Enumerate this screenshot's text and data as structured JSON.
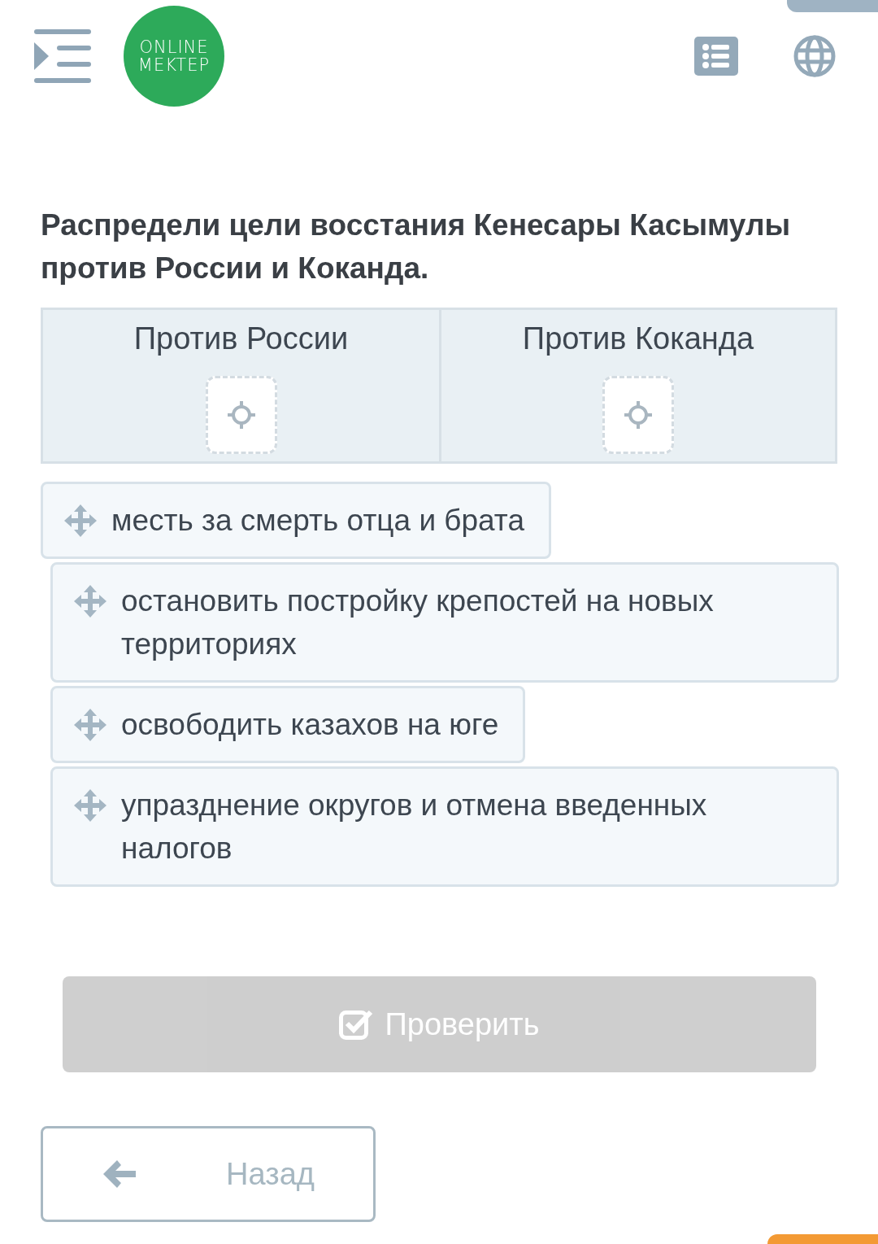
{
  "logo": {
    "line_1": "ONLINE",
    "line_2": "MEKTEP"
  },
  "question": "Распредели цели восстания Кенесары Касымулы против России и Коканда.",
  "categories": [
    {
      "label": "Против России"
    },
    {
      "label": "Против Коканда"
    }
  ],
  "items": [
    {
      "text": "месть за смерть отца и брата"
    },
    {
      "text": "остановить постройку крепостей на новых территориях"
    },
    {
      "text": "освободить казахов на юге"
    },
    {
      "text": "упразднение округов и отмена введенных налогов"
    }
  ],
  "check_button": {
    "label": "Проверить",
    "disabled": true
  },
  "back_button": {
    "label": "Назад"
  }
}
